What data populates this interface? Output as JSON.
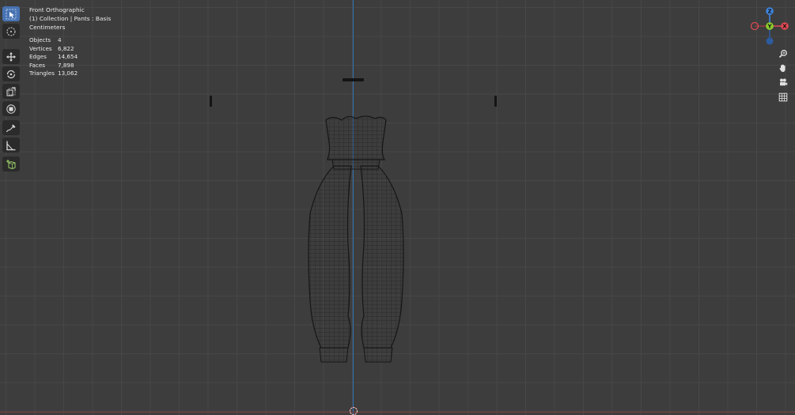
{
  "viewport": {
    "view_name": "Front Orthographic",
    "collection_line": "(1) Collection | Pants : Basis",
    "units": "Centimeters"
  },
  "stats": [
    {
      "label": "Objects",
      "value": "4"
    },
    {
      "label": "Vertices",
      "value": "6,822"
    },
    {
      "label": "Edges",
      "value": "14,654"
    },
    {
      "label": "Faces",
      "value": "7,898"
    },
    {
      "label": "Triangles",
      "value": "13,062"
    }
  ],
  "toolbar": [
    {
      "name": "select-tool",
      "icon": "cursor-select-icon",
      "active": true
    },
    {
      "name": "cursor-tool",
      "icon": "3d-cursor-icon",
      "active": false
    },
    {
      "name": "move-tool",
      "icon": "move-arrows-icon",
      "active": false
    },
    {
      "name": "rotate-tool",
      "icon": "rotate-icon",
      "active": false
    },
    {
      "name": "scale-tool",
      "icon": "scale-icon",
      "active": false
    },
    {
      "name": "transform-tool",
      "icon": "transform-icon",
      "active": false
    },
    {
      "name": "annotate-tool",
      "icon": "annotate-pen-icon",
      "active": false
    },
    {
      "name": "measure-tool",
      "icon": "measure-ruler-icon",
      "active": false
    },
    {
      "name": "add-cube-tool",
      "icon": "add-cube-icon",
      "active": false
    }
  ],
  "gizmo": {
    "x_label": "X",
    "y_label": "Y",
    "z_label": "Z"
  },
  "colors": {
    "accent": "#4772b3",
    "axis_x": "#e14a55",
    "axis_y": "#8ccd2c",
    "axis_z": "#3f86e0"
  }
}
